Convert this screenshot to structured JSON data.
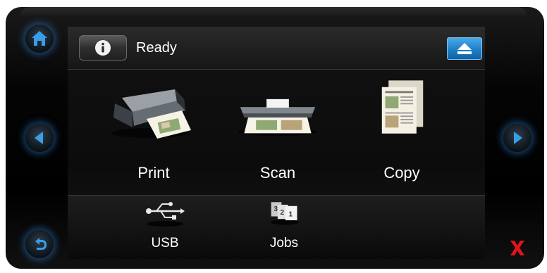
{
  "status": {
    "text": "Ready"
  },
  "main_tiles": [
    {
      "label": "Print",
      "icon": "printer-icon"
    },
    {
      "label": "Scan",
      "icon": "scanner-icon"
    },
    {
      "label": "Copy",
      "icon": "copy-icon"
    }
  ],
  "bottom_tiles": [
    {
      "label": "USB",
      "icon": "usb-icon"
    },
    {
      "label": "Jobs",
      "icon": "jobs-icon"
    }
  ],
  "hardware_buttons": {
    "home": "home-icon",
    "left": "left-arrow-icon",
    "right": "right-arrow-icon",
    "back": "back-icon",
    "cancel": "cancel-x-icon"
  },
  "colors": {
    "accent_blue": "#2a8ad4",
    "glow_blue": "#2878c8",
    "cancel_red": "#e0141a",
    "screen_bg": "#0c0c0c"
  }
}
